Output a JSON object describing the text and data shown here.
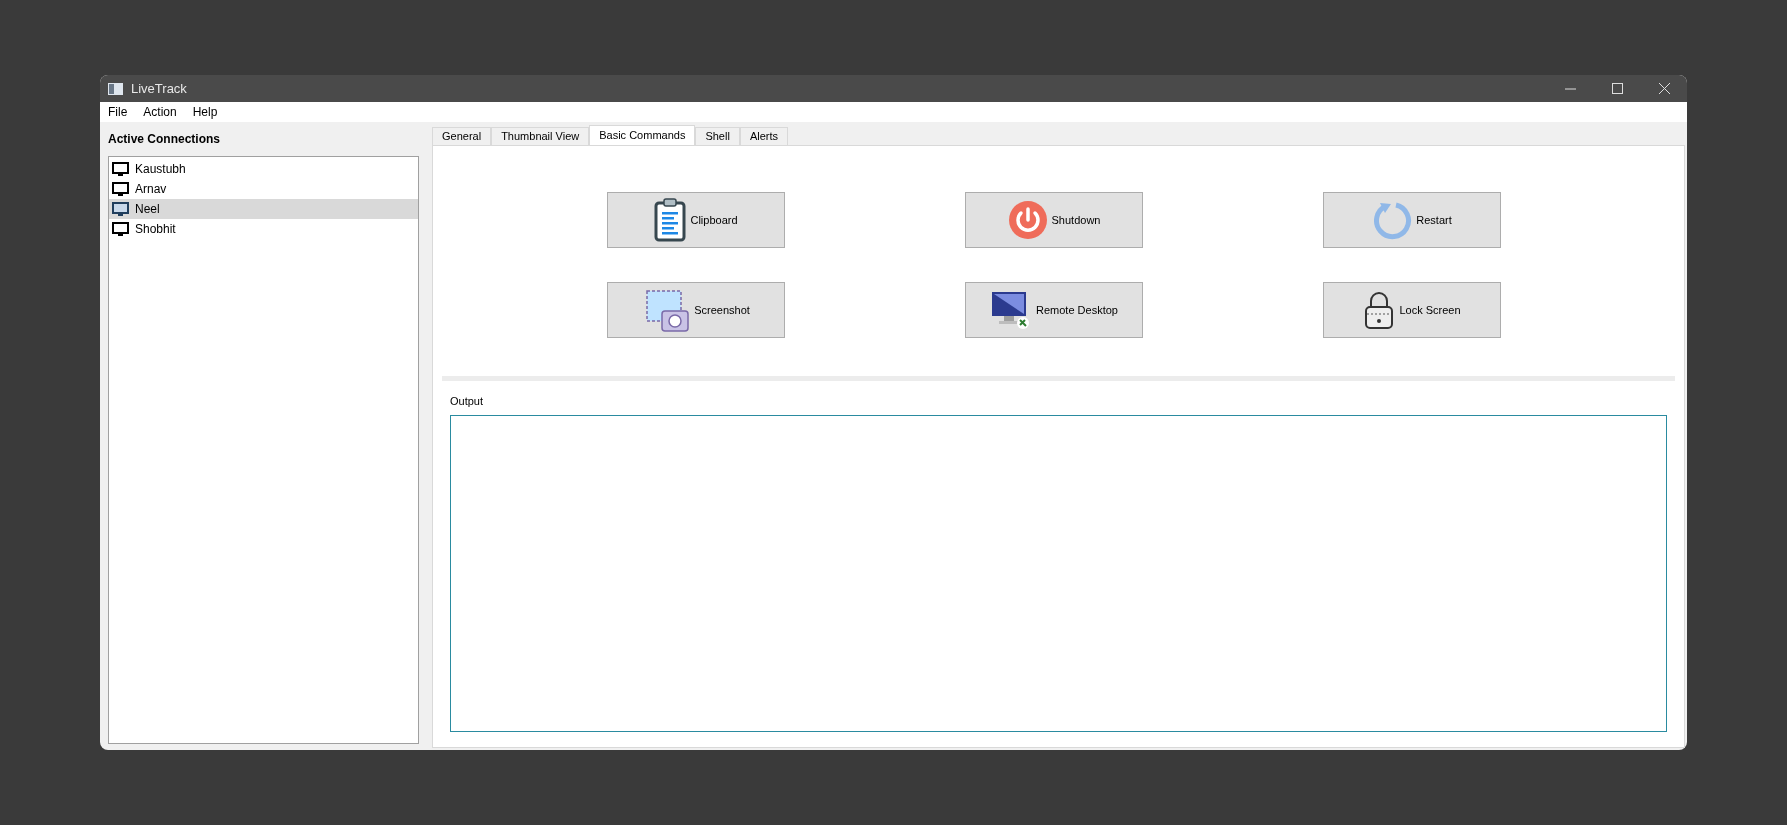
{
  "window": {
    "title": "LiveTrack"
  },
  "menu": [
    "File",
    "Action",
    "Help"
  ],
  "connections": {
    "title": "Active Connections",
    "items": [
      {
        "name": "Kaustubh",
        "selected": false
      },
      {
        "name": "Arnav",
        "selected": false
      },
      {
        "name": "Neel",
        "selected": true
      },
      {
        "name": "Shobhit",
        "selected": false
      }
    ]
  },
  "tabs": [
    {
      "label": "General",
      "selected": false
    },
    {
      "label": "Thumbnail View",
      "selected": false
    },
    {
      "label": "Basic Commands",
      "selected": true
    },
    {
      "label": "Shell",
      "selected": false
    },
    {
      "label": "Alerts",
      "selected": false
    }
  ],
  "commands": [
    {
      "kind": "clipboard",
      "label": "Clipboard"
    },
    {
      "kind": "shutdown",
      "label": "Shutdown"
    },
    {
      "kind": "restart",
      "label": "Restart"
    },
    {
      "kind": "screenshot",
      "label": "Screenshot"
    },
    {
      "kind": "remote",
      "label": "Remote Desktop"
    },
    {
      "kind": "lock",
      "label": "Lock Screen"
    }
  ],
  "output": {
    "label": "Output"
  }
}
